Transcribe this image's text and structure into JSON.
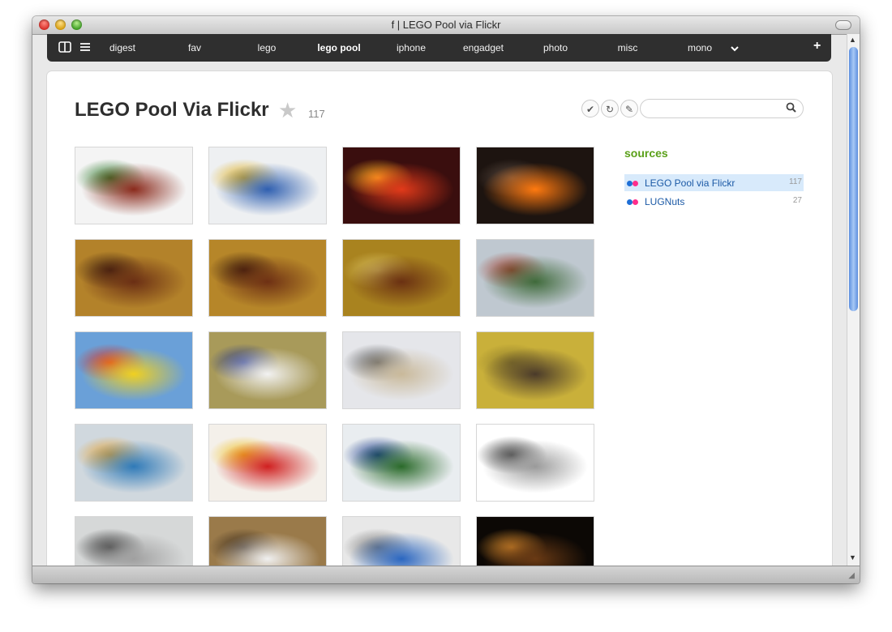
{
  "window": {
    "title": "f | LEGO Pool via Flickr"
  },
  "nav": {
    "items": [
      {
        "label": "digest",
        "active": false
      },
      {
        "label": "fav",
        "active": false
      },
      {
        "label": "lego",
        "active": false
      },
      {
        "label": "lego pool",
        "active": true
      },
      {
        "label": "iphone",
        "active": false
      },
      {
        "label": "engadget",
        "active": false
      },
      {
        "label": "photo",
        "active": false
      },
      {
        "label": "misc",
        "active": false
      },
      {
        "label": "mono",
        "active": false
      }
    ],
    "more_icon": "chevron-down-icon",
    "add_label": "+"
  },
  "page": {
    "title": "LEGO Pool Via Flickr",
    "count": "117",
    "star_icon": "star-icon"
  },
  "toolbar": {
    "check_icon": "✔",
    "refresh_icon": "↻",
    "edit_icon": "✎",
    "search_placeholder": "",
    "search_icon": "⚲"
  },
  "photos": [
    {
      "colors": [
        "#f4f4f4",
        "#8a2a1c",
        "#2e7a2c"
      ]
    },
    {
      "colors": [
        "#eef0f2",
        "#2f5fb0",
        "#e0b020"
      ]
    },
    {
      "colors": [
        "#3a0e0e",
        "#e23a1a",
        "#ffb020"
      ]
    },
    {
      "colors": [
        "#1d1410",
        "#ff7a10",
        "#5a4a40"
      ]
    },
    {
      "colors": [
        "#b3822a",
        "#6a2e14",
        "#3b1c0e"
      ]
    },
    {
      "colors": [
        "#b68629",
        "#6e3014",
        "#3a1a0c"
      ]
    },
    {
      "colors": [
        "#a9831f",
        "#6a3012",
        "#d8c060"
      ]
    },
    {
      "colors": [
        "#bfc8d0",
        "#3f6a3a",
        "#9e3a2a"
      ]
    },
    {
      "colors": [
        "#6aa0d8",
        "#f0d020",
        "#d83020"
      ]
    },
    {
      "colors": [
        "#a89a5a",
        "#f2f2f2",
        "#2a3a8a"
      ]
    },
    {
      "colors": [
        "#e5e6ea",
        "#c9b99a",
        "#5a5a5a"
      ]
    },
    {
      "colors": [
        "#c9b03a",
        "#4a3a2a",
        "#8c7a2a"
      ]
    },
    {
      "colors": [
        "#d0d8de",
        "#2f7ab8",
        "#e3a030"
      ]
    },
    {
      "colors": [
        "#f4f0ea",
        "#d02020",
        "#f0c020"
      ]
    },
    {
      "colors": [
        "#e9edf0",
        "#2a6a2a",
        "#1a3a8a"
      ]
    },
    {
      "colors": [
        "#ffffff",
        "#9a9a9a",
        "#3a3a3a"
      ]
    },
    {
      "colors": [
        "#d6d8d8",
        "#a0a0a0",
        "#3a3a3a"
      ]
    },
    {
      "colors": [
        "#9a7a4a",
        "#f0f0f0",
        "#3a2a1a"
      ]
    },
    {
      "colors": [
        "#e8e8e8",
        "#2a66c0",
        "#7a7a7a"
      ]
    },
    {
      "colors": [
        "#0c0805",
        "#6a3a14",
        "#d0862a"
      ]
    }
  ],
  "sidebar": {
    "heading": "sources",
    "sources": [
      {
        "name": "LEGO Pool via Flickr",
        "count": "117",
        "selected": true
      },
      {
        "name": "LUGNuts",
        "count": "27",
        "selected": false
      }
    ],
    "flickr_colors": [
      "#1f6fd6",
      "#ff2d8c"
    ]
  },
  "colors": {
    "navbar": "#2f2f2f",
    "accent_green": "#5aa019",
    "link_blue": "#1c5aa6",
    "selected_row": "#d8eafb"
  }
}
